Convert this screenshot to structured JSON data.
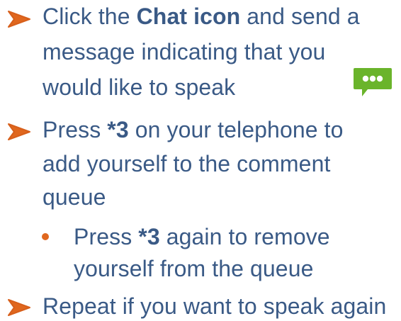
{
  "bullets": [
    {
      "lines": [
        {
          "parts": [
            {
              "text": "Click the ",
              "bold": false
            },
            {
              "text": "Chat icon",
              "bold": true
            },
            {
              "text": " and send a",
              "bold": false
            }
          ]
        },
        {
          "parts": [
            {
              "text": "message indicating that you",
              "bold": false
            }
          ]
        },
        {
          "parts": [
            {
              "text": "would like to speak",
              "bold": false
            }
          ]
        }
      ]
    },
    {
      "lines": [
        {
          "parts": [
            {
              "text": "Press ",
              "bold": false
            },
            {
              "text": "*3",
              "bold": true
            },
            {
              "text": " on your telephone to",
              "bold": false
            }
          ]
        },
        {
          "parts": [
            {
              "text": "add yourself to the comment",
              "bold": false
            }
          ]
        },
        {
          "parts": [
            {
              "text": "queue",
              "bold": false
            }
          ]
        }
      ]
    },
    {
      "sub": true,
      "lines": [
        {
          "parts": [
            {
              "text": "Press ",
              "bold": false
            },
            {
              "text": "*3",
              "bold": true
            },
            {
              "text": " again to remove",
              "bold": false
            }
          ]
        },
        {
          "parts": [
            {
              "text": "yourself from the queue",
              "bold": false
            }
          ]
        }
      ]
    },
    {
      "lines": [
        {
          "parts": [
            {
              "text": "Repeat if you want to speak again",
              "bold": false
            }
          ]
        }
      ]
    }
  ],
  "icons": {
    "bullet_marker": "orange-arrowhead-icon",
    "sub_bullet_marker": "orange-dot-icon",
    "chat": "chat-bubble-icon"
  },
  "colors": {
    "text": "#3a5a86",
    "marker": "#e0671e",
    "chat_icon": "#6ab42b"
  }
}
